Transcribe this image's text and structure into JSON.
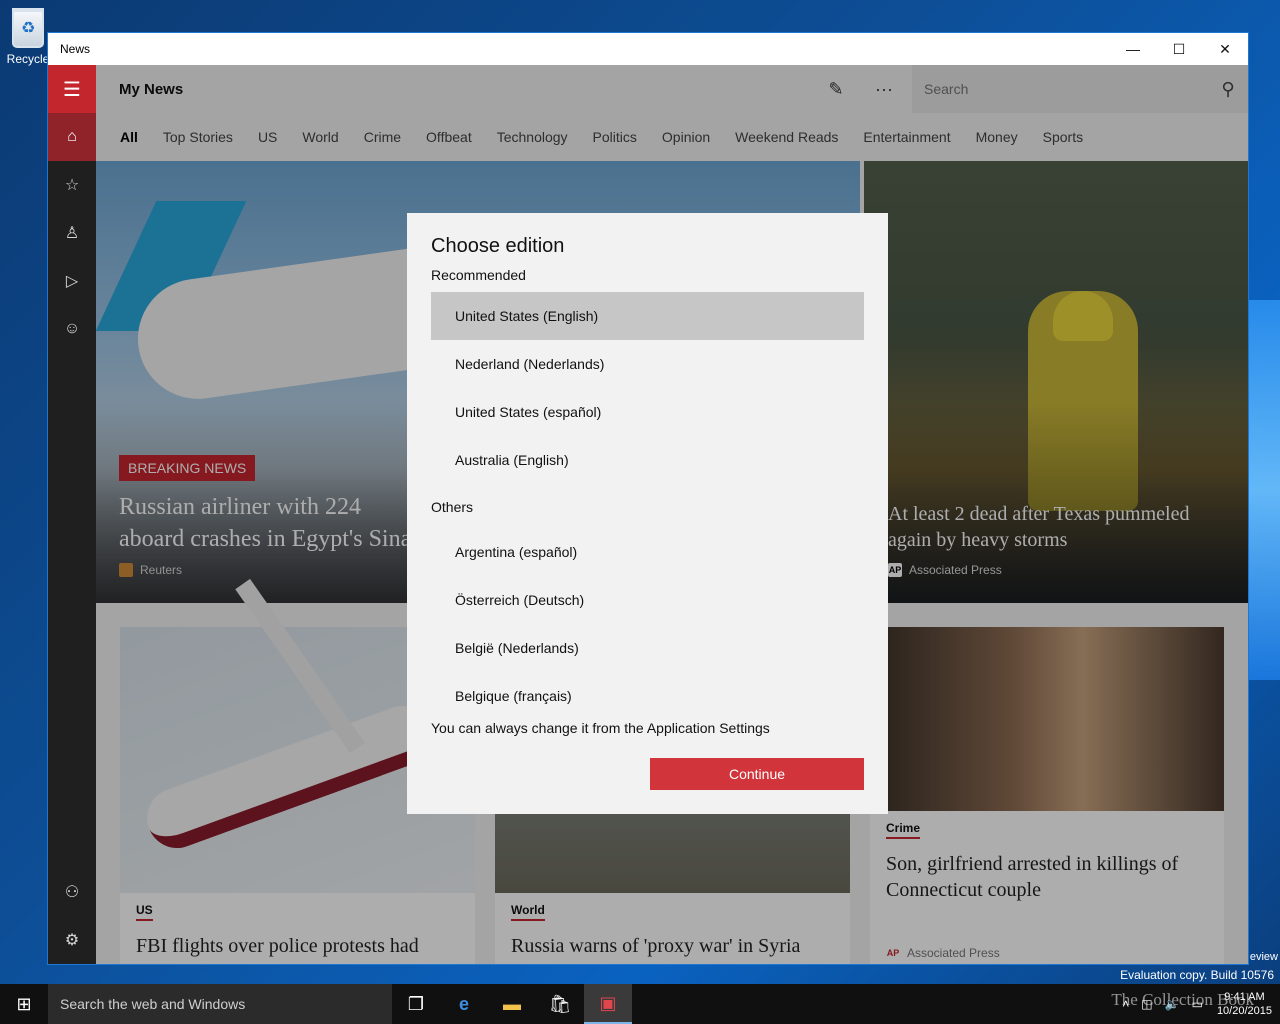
{
  "desktop": {
    "recycle_label": "Recycle",
    "evaluation": "Evaluation copy. Build 10576",
    "preview_fragment": "eview",
    "brand": "The Collection Book"
  },
  "window": {
    "title": "News",
    "minimize": "—",
    "maximize": "☐",
    "close": "✕"
  },
  "header": {
    "title": "My News",
    "search_placeholder": "Search"
  },
  "tabs": [
    "All",
    "Top Stories",
    "US",
    "World",
    "Crime",
    "Offbeat",
    "Technology",
    "Politics",
    "Opinion",
    "Weekend Reads",
    "Entertainment",
    "Money",
    "Sports"
  ],
  "hero": {
    "badge": "BREAKING NEWS",
    "left_title": "Russian airliner with 224 aboard crashes in Egypt's Sinai",
    "left_source": "Reuters",
    "right_title": "At least 2 dead after Texas pummeled again by heavy storms",
    "right_source": "Associated Press",
    "right_source_icon": "AP"
  },
  "cards": [
    {
      "category": "US",
      "title": "FBI flights over police protests had"
    },
    {
      "category": "World",
      "title": "Russia warns of 'proxy war' in Syria"
    },
    {
      "category": "Crime",
      "title": "Son, girlfriend arrested in killings of Connecticut couple",
      "source": "Associated Press",
      "source_icon": "AP"
    }
  ],
  "dialog": {
    "title": "Choose edition",
    "recommended_label": "Recommended",
    "recommended": [
      "United States (English)",
      "Nederland (Nederlands)",
      "United States (español)",
      "Australia (English)"
    ],
    "others_label": "Others",
    "others": [
      "Argentina (español)",
      "Österreich (Deutsch)",
      "België (Nederlands)",
      "Belgique (français)"
    ],
    "note": "You can always change it from the Application Settings",
    "continue": "Continue"
  },
  "taskbar": {
    "search_placeholder": "Search the web and Windows",
    "time": "9:41 AM",
    "date": "10/20/2015"
  }
}
